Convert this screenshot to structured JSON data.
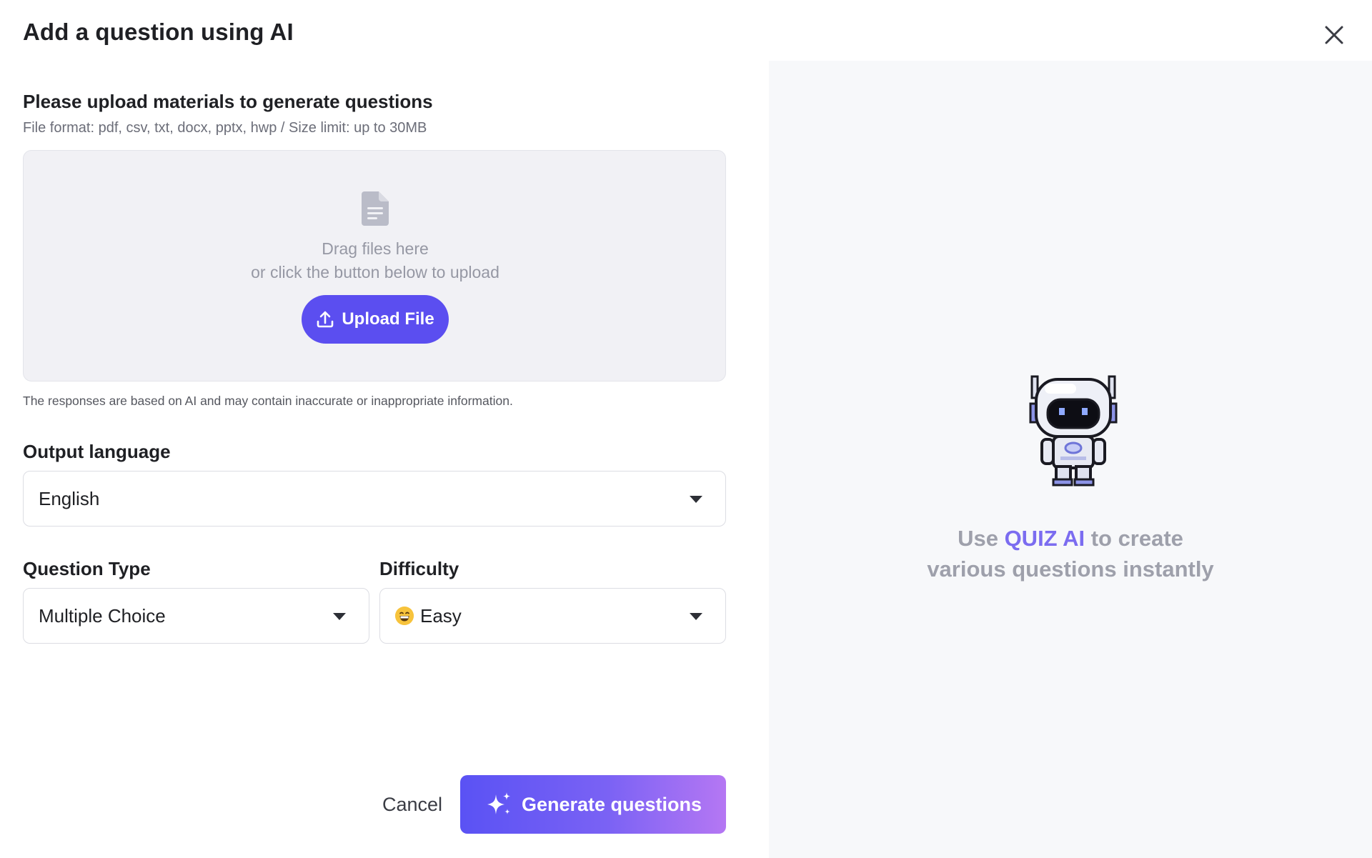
{
  "modal": {
    "title": "Add a question using AI",
    "close_icon": "close-icon"
  },
  "upload": {
    "title": "Please upload materials to generate questions",
    "subtitle": "File format: pdf, csv, txt, docx, pptx, hwp / Size limit: up to 30MB",
    "drop_line1": "Drag files here",
    "drop_line2": "or click the button below to upload",
    "button_label": "Upload File",
    "icons": {
      "file": "file-icon",
      "upload": "upload-icon"
    }
  },
  "disclaimer": "The responses are based on AI and may contain inaccurate or inappropriate information.",
  "output_language": {
    "label": "Output language",
    "value": "English"
  },
  "question_type": {
    "label": "Question Type",
    "value": "Multiple Choice"
  },
  "difficulty": {
    "label": "Difficulty",
    "emoji": "grinning-face-emoji",
    "value": "Easy"
  },
  "actions": {
    "cancel": "Cancel",
    "generate": "Generate questions",
    "generate_icon": "sparkles-icon"
  },
  "promo": {
    "prefix": "Use ",
    "brand": "QUIZ AI",
    "suffix": " to create",
    "line2": "various questions instantly",
    "illustration": "robot-illustration"
  },
  "colors": {
    "accent": "#5b4ef0",
    "brand_text": "#7b6cf0",
    "gradient_end": "#b577f3",
    "panel_bg": "#f7f8fa",
    "dropzone_bg": "#f1f1f5"
  }
}
